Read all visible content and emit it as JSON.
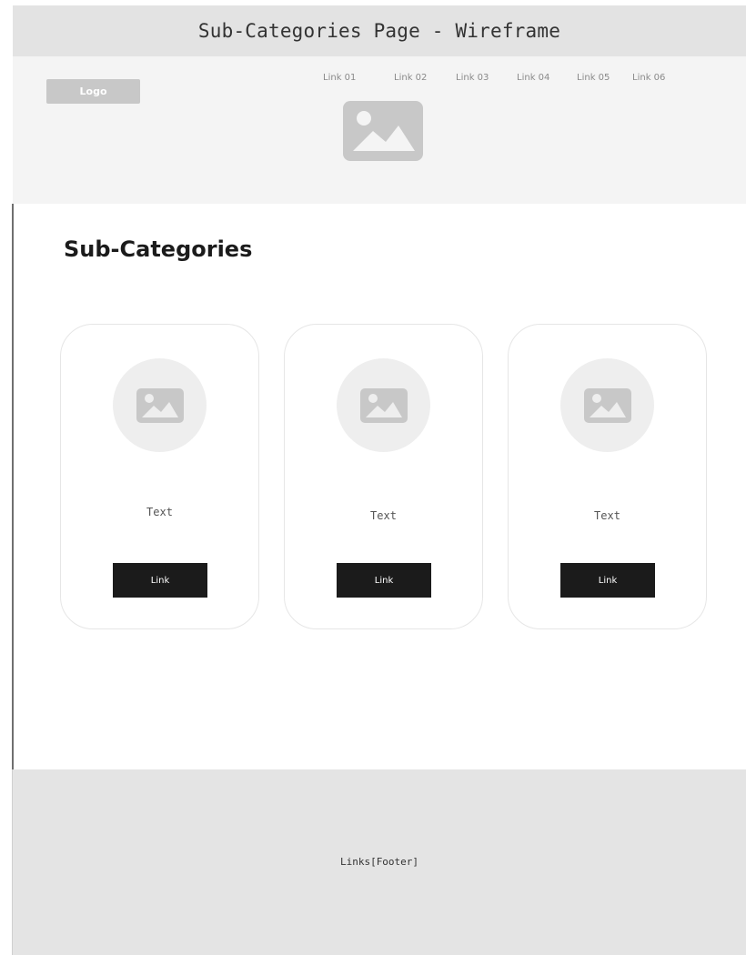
{
  "window": {
    "title": "Sub-Categories Page - Wireframe"
  },
  "header": {
    "logo_label": "Logo",
    "nav": [
      "Link 01",
      "Link 02",
      "Link 03",
      "Link 04",
      "Link 05",
      "Link 06"
    ],
    "hero_image_icon": "image-icon"
  },
  "main": {
    "title": "Sub-Categories",
    "cards": [
      {
        "image_icon": "image-icon",
        "text": "Text",
        "button_label": "Link"
      },
      {
        "image_icon": "image-icon",
        "text": "Text",
        "button_label": "Link"
      },
      {
        "image_icon": "image-icon",
        "text": "Text",
        "button_label": "Link"
      }
    ]
  },
  "footer": {
    "text": "Links[Footer]"
  },
  "colors": {
    "title_bar": "#e3e3e3",
    "header_bg": "#f4f4f4",
    "placeholder": "#c8c8c8",
    "button_bg": "#1b1b1b",
    "footer_bg": "#e4e4e4"
  }
}
